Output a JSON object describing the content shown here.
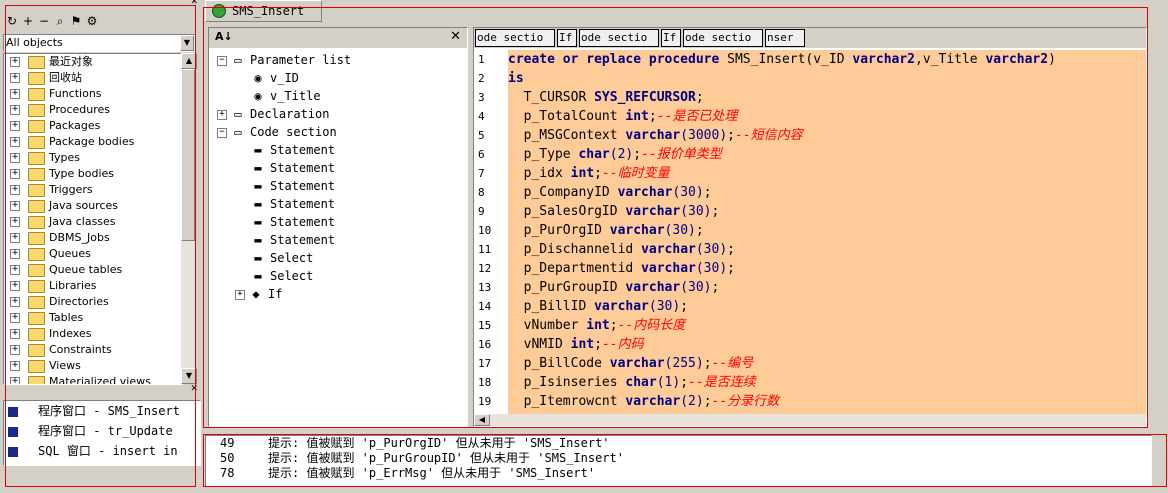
{
  "left_panel": {
    "filter_value": "All objects",
    "tree_items": [
      "最近对象",
      "回收站",
      "Functions",
      "Procedures",
      "Packages",
      "Package bodies",
      "Types",
      "Type bodies",
      "Triggers",
      "Java sources",
      "Java classes",
      "DBMS_Jobs",
      "Queues",
      "Queue tables",
      "Libraries",
      "Directories",
      "Tables",
      "Indexes",
      "Constraints",
      "Views",
      "Materialized views"
    ],
    "windows": [
      {
        "label": "程序窗口 - SMS_Insert"
      },
      {
        "label": "程序窗口 - tr_Update"
      },
      {
        "label": "SQL 窗口 - insert in"
      }
    ]
  },
  "editor": {
    "tab_label": "SMS_Insert",
    "crumbs": [
      "ode sectio",
      "If",
      "ode sectio",
      "If",
      "ode sectio",
      "nser"
    ],
    "outline": {
      "parameter_list": "Parameter list",
      "params": [
        "v_ID",
        "v_Title"
      ],
      "declaration": "Declaration",
      "code_section": "Code section",
      "statements": [
        "Statement",
        "Statement",
        "Statement",
        "Statement",
        "Statement",
        "Statement"
      ],
      "selects": [
        "Select",
        "Select"
      ],
      "if_node": "If"
    },
    "line_numbers": [
      "1",
      "2",
      "3",
      "4",
      "5",
      "6",
      "7",
      "8",
      "9",
      "10",
      "11",
      "12",
      "13",
      "14",
      "15",
      "16",
      "17",
      "18",
      "19"
    ],
    "code_lines": [
      {
        "segs": [
          {
            "t": "create or replace procedure ",
            "c": "kw"
          },
          {
            "t": "SMS_Insert(v_ID ",
            "c": "pn"
          },
          {
            "t": "varchar2",
            "c": "ty"
          },
          {
            "t": ",v_Title ",
            "c": "pn"
          },
          {
            "t": "varchar2",
            "c": "ty"
          },
          {
            "t": ")",
            "c": "pn"
          }
        ]
      },
      {
        "segs": [
          {
            "t": "is",
            "c": "kw"
          }
        ]
      },
      {
        "segs": [
          {
            "t": "  T_CURSOR ",
            "c": "pn"
          },
          {
            "t": "SYS_REFCURSOR",
            "c": "ty"
          },
          {
            "t": ";",
            "c": "pn"
          }
        ]
      },
      {
        "segs": [
          {
            "t": "  p_TotalCount ",
            "c": "pn"
          },
          {
            "t": "int",
            "c": "ty"
          },
          {
            "t": ";",
            "c": "pn"
          },
          {
            "t": "--是否已处理",
            "c": "cm"
          }
        ]
      },
      {
        "segs": [
          {
            "t": "  p_MSGContext ",
            "c": "pn"
          },
          {
            "t": "varchar",
            "c": "ty"
          },
          {
            "t": "(3000)",
            "c": "num"
          },
          {
            "t": ";",
            "c": "pn"
          },
          {
            "t": "--短信内容",
            "c": "cm"
          }
        ]
      },
      {
        "segs": [
          {
            "t": "  p_Type ",
            "c": "pn"
          },
          {
            "t": "char",
            "c": "ty"
          },
          {
            "t": "(2)",
            "c": "num"
          },
          {
            "t": ";",
            "c": "pn"
          },
          {
            "t": "--报价单类型",
            "c": "cm"
          }
        ]
      },
      {
        "segs": [
          {
            "t": "  p_idx ",
            "c": "pn"
          },
          {
            "t": "int",
            "c": "ty"
          },
          {
            "t": ";",
            "c": "pn"
          },
          {
            "t": "--临时变量",
            "c": "cm"
          }
        ]
      },
      {
        "segs": [
          {
            "t": "  p_CompanyID ",
            "c": "pn"
          },
          {
            "t": "varchar",
            "c": "ty"
          },
          {
            "t": "(30)",
            "c": "num"
          },
          {
            "t": ";",
            "c": "pn"
          }
        ]
      },
      {
        "segs": [
          {
            "t": "  p_SalesOrgID ",
            "c": "pn"
          },
          {
            "t": "varchar",
            "c": "ty"
          },
          {
            "t": "(30)",
            "c": "num"
          },
          {
            "t": ";",
            "c": "pn"
          }
        ]
      },
      {
        "segs": [
          {
            "t": "  p_PurOrgID ",
            "c": "pn"
          },
          {
            "t": "varchar",
            "c": "ty"
          },
          {
            "t": "(30)",
            "c": "num"
          },
          {
            "t": ";",
            "c": "pn"
          }
        ]
      },
      {
        "segs": [
          {
            "t": "  p_Dischannelid ",
            "c": "pn"
          },
          {
            "t": "varchar",
            "c": "ty"
          },
          {
            "t": "(30)",
            "c": "num"
          },
          {
            "t": ";",
            "c": "pn"
          }
        ]
      },
      {
        "segs": [
          {
            "t": "  p_Departmentid ",
            "c": "pn"
          },
          {
            "t": "varchar",
            "c": "ty"
          },
          {
            "t": "(30)",
            "c": "num"
          },
          {
            "t": ";",
            "c": "pn"
          }
        ]
      },
      {
        "segs": [
          {
            "t": "  p_PurGroupID ",
            "c": "pn"
          },
          {
            "t": "varchar",
            "c": "ty"
          },
          {
            "t": "(30)",
            "c": "num"
          },
          {
            "t": ";",
            "c": "pn"
          }
        ]
      },
      {
        "segs": [
          {
            "t": "  p_BillID ",
            "c": "pn"
          },
          {
            "t": "varchar",
            "c": "ty"
          },
          {
            "t": "(30)",
            "c": "num"
          },
          {
            "t": ";",
            "c": "pn"
          }
        ]
      },
      {
        "segs": [
          {
            "t": "  vNumber ",
            "c": "pn"
          },
          {
            "t": "int",
            "c": "ty"
          },
          {
            "t": ";",
            "c": "pn"
          },
          {
            "t": "--内码长度",
            "c": "cm"
          }
        ]
      },
      {
        "segs": [
          {
            "t": "  vNMID ",
            "c": "pn"
          },
          {
            "t": "int",
            "c": "ty"
          },
          {
            "t": ";",
            "c": "pn"
          },
          {
            "t": "--内码",
            "c": "cm"
          }
        ]
      },
      {
        "segs": [
          {
            "t": "  p_BillCode ",
            "c": "pn"
          },
          {
            "t": "varchar",
            "c": "ty"
          },
          {
            "t": "(255)",
            "c": "num"
          },
          {
            "t": ";",
            "c": "pn"
          },
          {
            "t": "--编号",
            "c": "cm"
          }
        ]
      },
      {
        "segs": [
          {
            "t": "  p_Isinseries ",
            "c": "pn"
          },
          {
            "t": "char",
            "c": "ty"
          },
          {
            "t": "(1)",
            "c": "num"
          },
          {
            "t": ";",
            "c": "pn"
          },
          {
            "t": "--是否连续",
            "c": "cm"
          }
        ]
      },
      {
        "segs": [
          {
            "t": "  p_Itemrowcnt ",
            "c": "pn"
          },
          {
            "t": "varchar",
            "c": "ty"
          },
          {
            "t": "(2)",
            "c": "num"
          },
          {
            "t": ";",
            "c": "pn"
          },
          {
            "t": "--分录行数",
            "c": "cm"
          }
        ]
      }
    ]
  },
  "messages": [
    {
      "line": "49",
      "text": "提示: 值被赋到 'p_PurOrgID' 但从未用于 'SMS_Insert'"
    },
    {
      "line": "50",
      "text": "提示: 值被赋到 'p_PurGroupID' 但从未用于 'SMS_Insert'"
    },
    {
      "line": "78",
      "text": "提示: 值被赋到 'p_ErrMsg' 但从未用于 'SMS_Insert'"
    }
  ],
  "colors": {
    "code_bg": "#ffcc99",
    "keyword": "#000080",
    "comment": "#ff0000",
    "frame": "#e00000"
  }
}
